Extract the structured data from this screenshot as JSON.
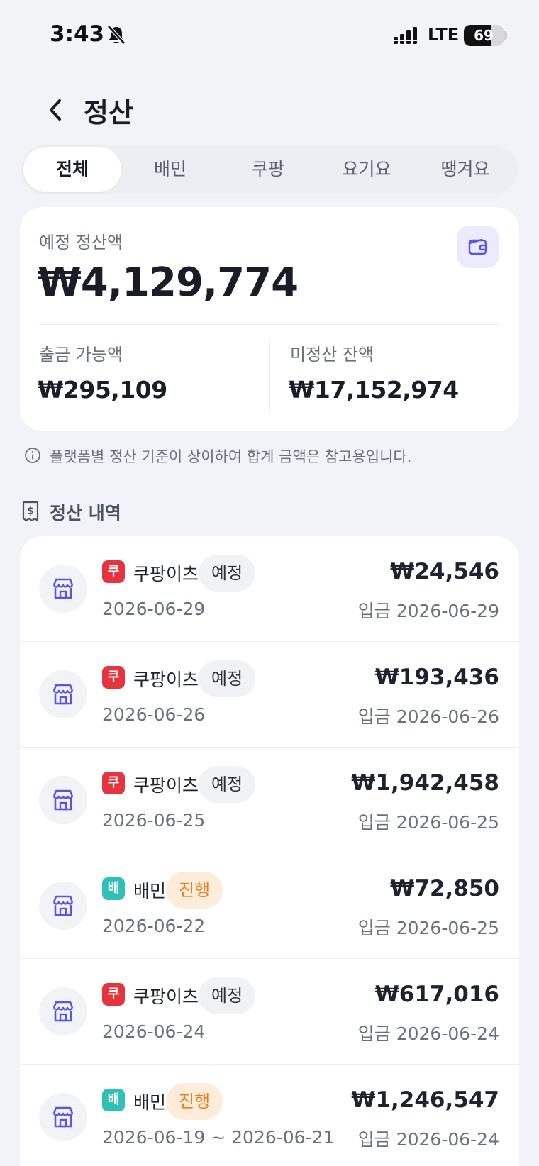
{
  "status_bar": {
    "time": "3:43",
    "network": "LTE",
    "battery": "69",
    "battery_level_pct": 69
  },
  "header": {
    "title": "정산",
    "back_icon": "chevron-left-icon"
  },
  "tabs": [
    {
      "label": "전체",
      "active": true
    },
    {
      "label": "배민",
      "active": false
    },
    {
      "label": "쿠팡",
      "active": false
    },
    {
      "label": "요기요",
      "active": false
    },
    {
      "label": "땡겨요",
      "active": false
    }
  ],
  "summary": {
    "expected_label": "예정 정산액",
    "expected_amount": "₩4,129,774",
    "wallet_icon": "wallet-icon",
    "withdrawable_label": "출금 가능액",
    "withdrawable_amount": "₩295,109",
    "unsettled_label": "미정산 잔액",
    "unsettled_amount": "₩17,152,974"
  },
  "info_note": "플랫폼별 정산 기준이 상이하여 합계 금액은 참고용입니다.",
  "section_title": "정산 내역",
  "colors": {
    "accent": "#5a55e8",
    "coupang_badge": "#e5343d",
    "baemin_badge": "#2fc1b7",
    "scheduled_pill_bg": "#f1f2f5",
    "in_progress_pill_bg": "#fdecd9",
    "in_progress_pill_text": "#e8811a"
  },
  "settlements": [
    {
      "badge": "쿠",
      "platform": "쿠팡이츠",
      "status": "예정",
      "status_type": "scheduled",
      "period": "2026-06-29",
      "amount": "₩24,546",
      "deposit": "입금 2026-06-29"
    },
    {
      "badge": "쿠",
      "platform": "쿠팡이츠",
      "status": "예정",
      "status_type": "scheduled",
      "period": "2026-06-26",
      "amount": "₩193,436",
      "deposit": "입금 2026-06-26"
    },
    {
      "badge": "쿠",
      "platform": "쿠팡이츠",
      "status": "예정",
      "status_type": "scheduled",
      "period": "2026-06-25",
      "amount": "₩1,942,458",
      "deposit": "입금 2026-06-25"
    },
    {
      "badge": "배",
      "platform": "배민",
      "status": "진행",
      "status_type": "in_progress",
      "period": "2026-06-22",
      "amount": "₩72,850",
      "deposit": "입금 2026-06-25"
    },
    {
      "badge": "쿠",
      "platform": "쿠팡이츠",
      "status": "예정",
      "status_type": "scheduled",
      "period": "2026-06-24",
      "amount": "₩617,016",
      "deposit": "입금 2026-06-24"
    },
    {
      "badge": "배",
      "platform": "배민",
      "status": "진행",
      "status_type": "in_progress",
      "period": "2026-06-19 ~ 2026-06-21",
      "amount": "₩1,246,547",
      "deposit": "입금 2026-06-24"
    }
  ]
}
